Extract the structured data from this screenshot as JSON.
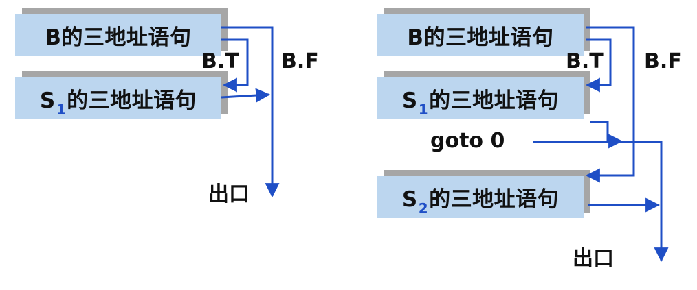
{
  "left": {
    "b_box": {
      "text": "B的三地址语句"
    },
    "s1_box": {
      "prefix": "S",
      "sub": "1",
      "rest": "的三地址语句"
    },
    "bt_label": "B.T",
    "bf_label": "B.F",
    "exit_label": "出口"
  },
  "right": {
    "b_box": {
      "text": "B的三地址语句"
    },
    "s1_box": {
      "prefix": "S",
      "sub": "1",
      "rest": "的三地址语句"
    },
    "goto_label": "goto 0",
    "s2_box": {
      "prefix": "S",
      "sub": "2",
      "rest": "的三地址语句"
    },
    "bt_label": "B.T",
    "bf_label": "B.F",
    "exit_label": "出口"
  },
  "colors": {
    "arrow": "#1f4fc6",
    "box_fill": "#bcd6ef",
    "box_shadow": "#a6a6a6"
  }
}
